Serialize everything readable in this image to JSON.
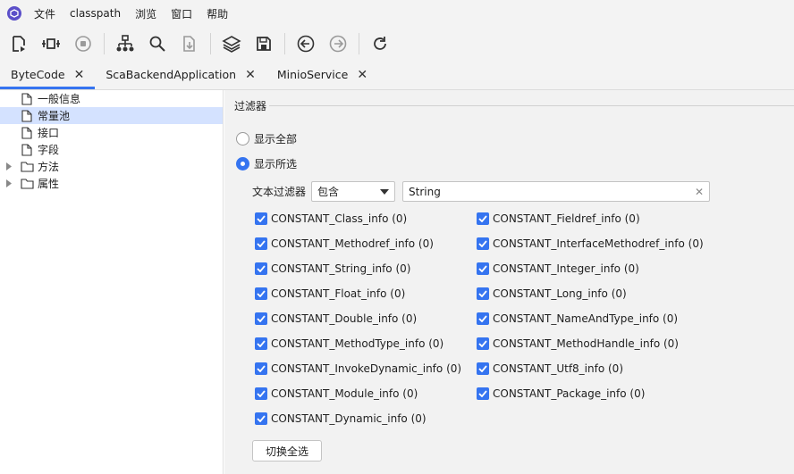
{
  "menu": [
    "文件",
    "classpath",
    "浏览",
    "窗口",
    "帮助"
  ],
  "toolbar_icons": [
    "open-file-icon",
    "decompile-icon",
    "stop-icon",
    "hierarchy-icon",
    "search-icon",
    "export-icon",
    "layers-icon",
    "save-icon",
    "back-icon",
    "forward-icon",
    "refresh-icon"
  ],
  "tabs": [
    {
      "label": "ByteCode",
      "active": true
    },
    {
      "label": "ScaBackendApplication",
      "active": false
    },
    {
      "label": "MinioService",
      "active": false
    }
  ],
  "tree": [
    {
      "label": "一般信息",
      "type": "file",
      "selected": false
    },
    {
      "label": "常量池",
      "type": "file",
      "selected": true
    },
    {
      "label": "接口",
      "type": "file",
      "selected": false
    },
    {
      "label": "字段",
      "type": "file",
      "selected": false
    },
    {
      "label": "方法",
      "type": "folder",
      "selected": false
    },
    {
      "label": "属性",
      "type": "folder",
      "selected": false
    }
  ],
  "filter": {
    "title": "过滤器",
    "radio_all": "显示全部",
    "radio_selected": "显示所选",
    "text_filter_label": "文本过滤器",
    "mode_value": "包含",
    "text_value": "String",
    "toggle_button": "切换全选"
  },
  "checkboxes_left": [
    "CONSTANT_Class_info (0)",
    "CONSTANT_Methodref_info (0)",
    "CONSTANT_String_info (0)",
    "CONSTANT_Float_info (0)",
    "CONSTANT_Double_info (0)",
    "CONSTANT_MethodType_info (0)",
    "CONSTANT_InvokeDynamic_info (0)",
    "CONSTANT_Module_info (0)",
    "CONSTANT_Dynamic_info (0)"
  ],
  "checkboxes_right": [
    "CONSTANT_Fieldref_info (0)",
    "CONSTANT_InterfaceMethodref_info (0)",
    "CONSTANT_Integer_info (0)",
    "CONSTANT_Long_info (0)",
    "CONSTANT_NameAndType_info (0)",
    "CONSTANT_MethodHandle_info (0)",
    "CONSTANT_Utf8_info (0)",
    "CONSTANT_Package_info (0)"
  ],
  "colors": {
    "accent": "#3574f0",
    "selection": "#d4e2ff",
    "panel_bg": "#f2f2f2"
  }
}
